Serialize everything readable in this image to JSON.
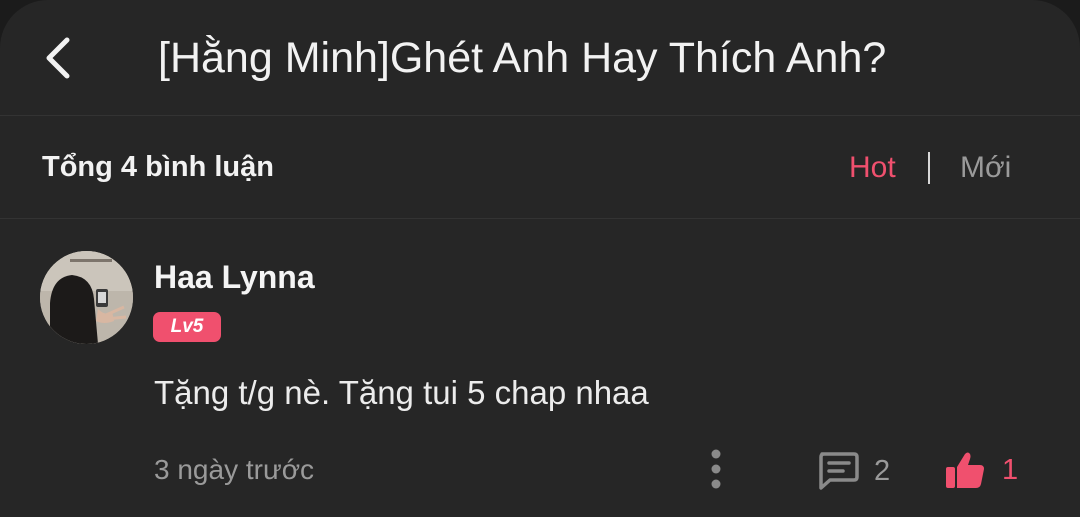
{
  "header": {
    "title": "[Hằng Minh]Ghét Anh Hay Thích Anh?",
    "back_icon": "chevron-left-icon"
  },
  "comments_bar": {
    "total_label": "Tổng 4 bình luận",
    "sort_hot": "Hot",
    "sort_new": "Mới",
    "active_sort": "Hot"
  },
  "comment": {
    "username": "Haa Lynna",
    "level": "Lv5",
    "text": "Tặng t/g nè. Tặng tui 5 chap nhaa",
    "time": "3 ngày trước",
    "reply_count": "2",
    "like_count": "1",
    "icons": {
      "more": "more-vertical-icon",
      "reply": "comment-icon",
      "like": "thumbs-up-icon"
    }
  },
  "colors": {
    "accent": "#f0506e",
    "background": "#262626",
    "text_primary": "#f2f2f2",
    "text_muted": "#9a9a9a"
  }
}
